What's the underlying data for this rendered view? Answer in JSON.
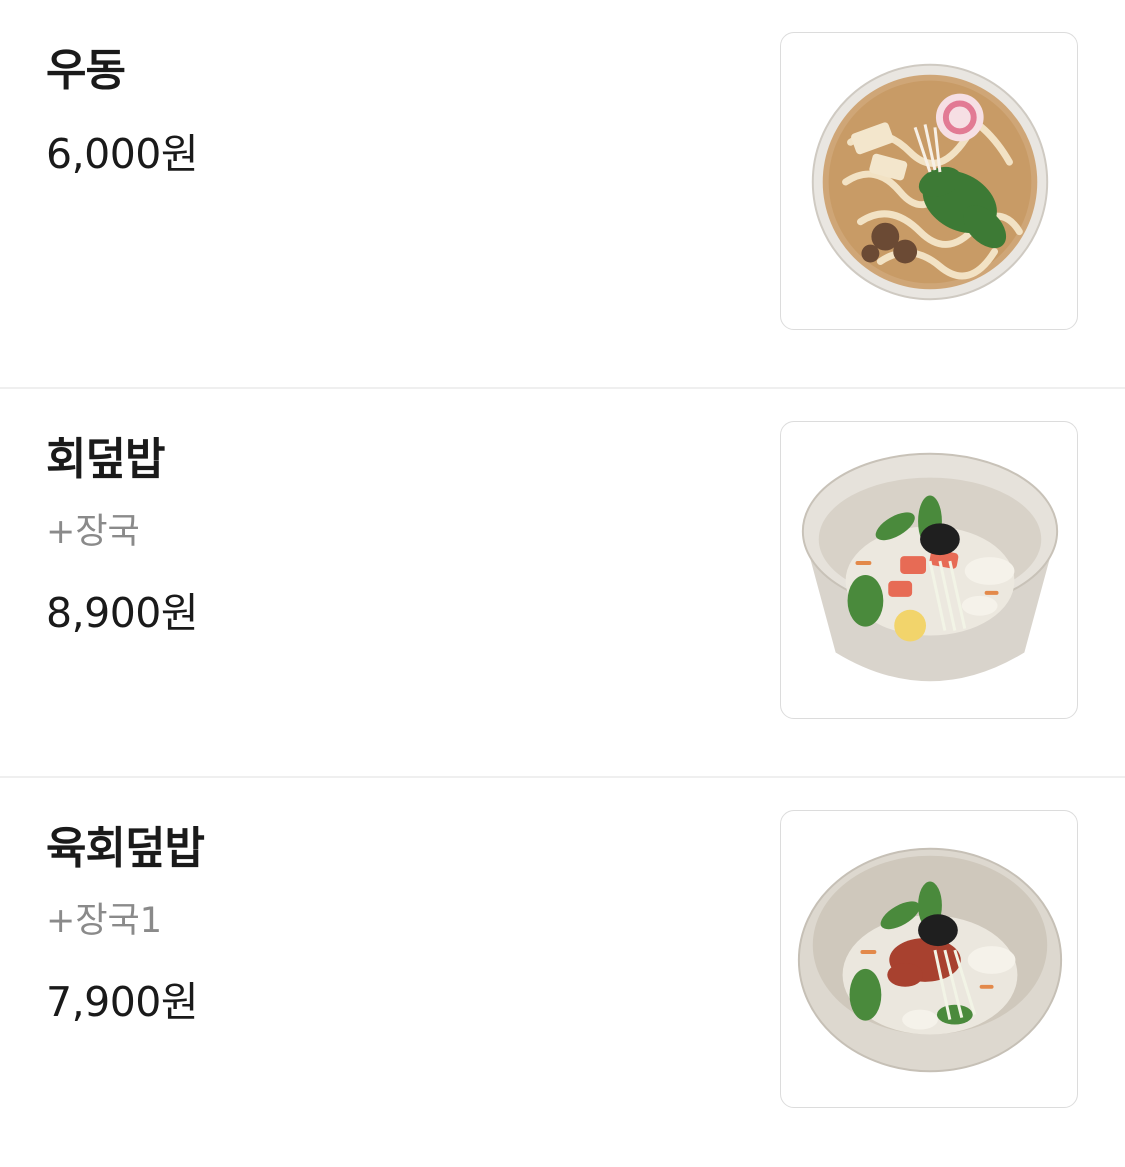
{
  "menu": {
    "items": [
      {
        "name": "우동",
        "desc": "",
        "price": "6,000원",
        "image_icon": "udon-bowl-photo"
      },
      {
        "name": "회덮밥",
        "desc": "+장국",
        "price": "8,900원",
        "image_icon": "raw-fish-rice-bowl-photo"
      },
      {
        "name": "육회덮밥",
        "desc": "+장국1",
        "price": "7,900원",
        "image_icon": "beef-tartare-rice-bowl-photo"
      }
    ]
  },
  "colors": {
    "text": "#1a1a1a",
    "subtext": "#8a8a8a",
    "divider": "#efefef",
    "thumb_border": "#dcdcdc"
  }
}
